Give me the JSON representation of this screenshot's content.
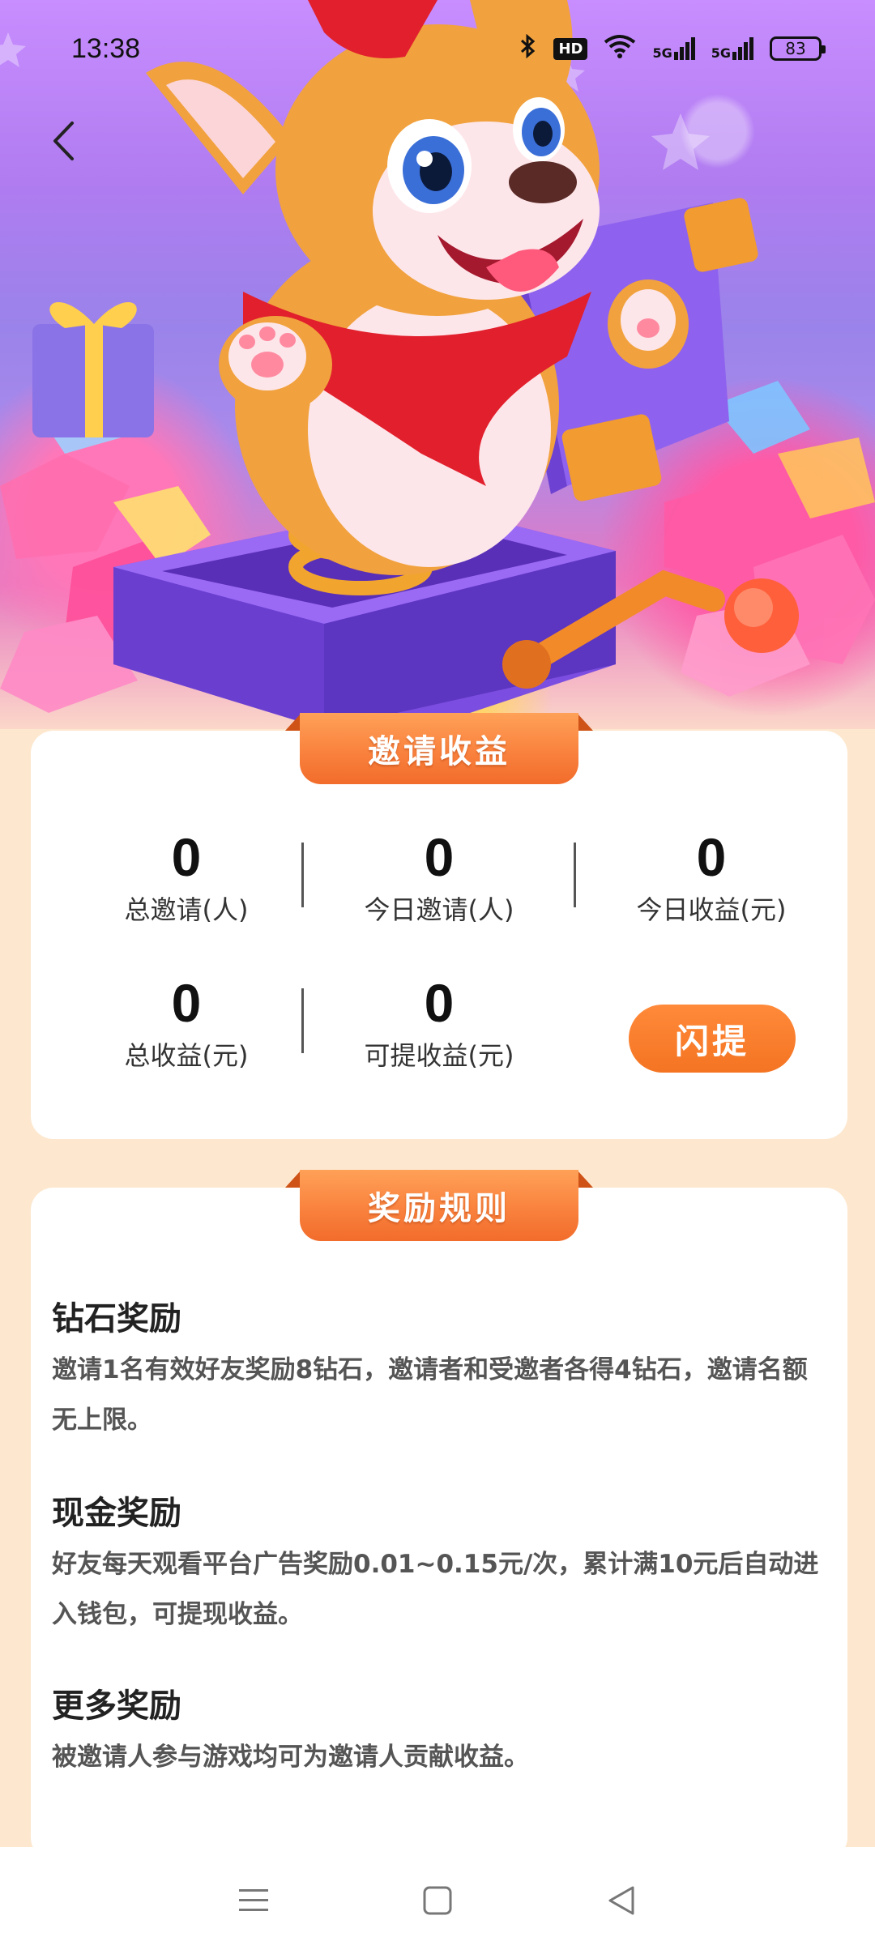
{
  "status_bar": {
    "time": "13:38",
    "bluetooth_icon": "bluetooth-icon",
    "hd_label": "HD",
    "wifi_icon": "wifi-icon",
    "signal1_label": "5G",
    "signal2_label": "5G",
    "battery_level": "83"
  },
  "nav": {
    "back_icon": "chevron-left-icon"
  },
  "invite_card": {
    "title": "邀请收益",
    "stats": [
      {
        "value": "0",
        "label": "总邀请(人)"
      },
      {
        "value": "0",
        "label": "今日邀请(人)"
      },
      {
        "value": "0",
        "label": "今日收益(元)"
      },
      {
        "value": "0",
        "label": "总收益(元)"
      },
      {
        "value": "0",
        "label": "可提收益(元)"
      }
    ],
    "withdraw_button": "闪提"
  },
  "rules_card": {
    "title": "奖励规则",
    "rules": [
      {
        "heading": "钻石奖励",
        "line1": "邀请1名有效好友奖励8钻石，邀请者和受邀者各得4钻石，邀请名额",
        "line2": "无上限。"
      },
      {
        "heading": "现金奖励",
        "line1": "好友每天观看平台广告奖励0.01~0.15元/次，累计满10元后自动进",
        "line2": "入钱包，可提现收益。"
      },
      {
        "heading": "更多奖励",
        "line1": "被邀请人参与游戏均可为邀请人贡献收益。",
        "line2": ""
      }
    ]
  },
  "system_nav": {
    "menu_icon": "menu-icon",
    "home_icon": "home-square-icon",
    "back_icon": "back-triangle-icon"
  },
  "colors": {
    "accent": "#f47422",
    "page_bg": "#fde8cf",
    "card_bg": "#ffffff"
  }
}
